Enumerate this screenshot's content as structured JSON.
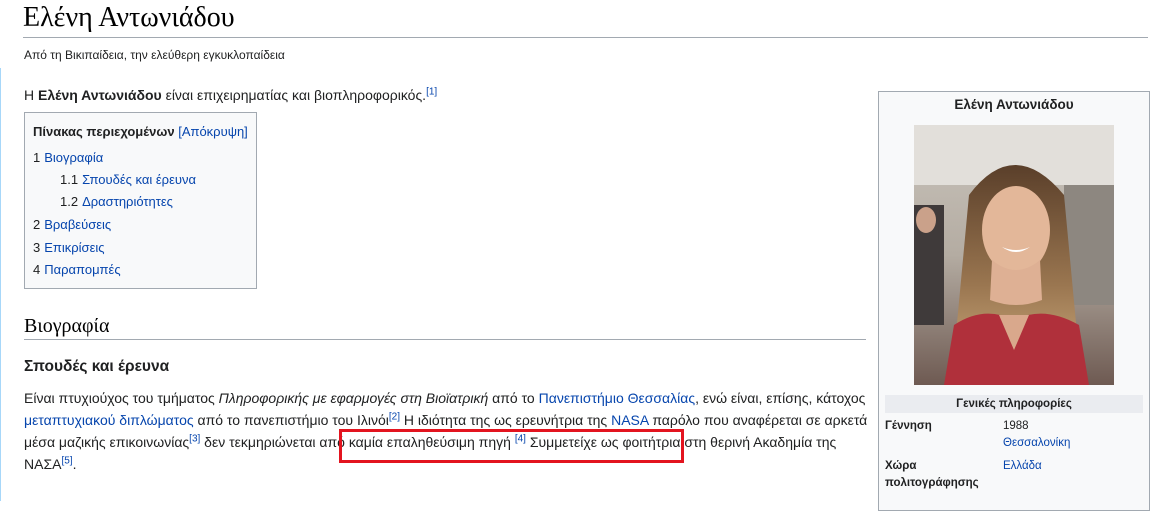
{
  "page": {
    "title": "Ελένη Αντωνιάδου",
    "tagline": "Από τη Βικιπαίδεια, την ελεύθερη εγκυκλοπαίδεια"
  },
  "intro": {
    "prefix": "Η ",
    "name_bold": "Ελένη Αντωνιάδου",
    "suffix": " είναι επιχειρηματίας και βιοπληροφορικός.",
    "ref": "[1]"
  },
  "toc": {
    "title": "Πίνακας περιεχομένων",
    "toggle": "[Απόκρυψη]",
    "items": [
      {
        "num": "1",
        "label": "Βιογραφία"
      },
      {
        "num": "1.1",
        "label": "Σπουδές και έρευνα"
      },
      {
        "num": "1.2",
        "label": "Δραστηριότητες"
      },
      {
        "num": "2",
        "label": "Βραβεύσεις"
      },
      {
        "num": "3",
        "label": "Επικρίσεις"
      },
      {
        "num": "4",
        "label": "Παραπομπές"
      }
    ]
  },
  "section": {
    "heading": "Βιογραφία",
    "subheading": "Σπουδές και έρευνα"
  },
  "paragraph": {
    "t1": "Είναι πτυχιούχος του τμήματος ",
    "t2_italic": "Πληροφορικής με εφαρμογές στη Βιοϊατρική",
    "t3": " από το ",
    "link_university": "Πανεπιστήμιο Θεσσαλίας",
    "t4": ", ενώ είναι, επίσης, κάτοχος  ",
    "link_masters": "μεταπτυχιακού διπλώματος",
    "t5": " από το πανεπιστήμιο του Ιλινόι",
    "ref2": "[2]",
    "t6": " Η ιδιότητα της ως ερευνήτρια της ",
    "link_nasa": "NASA",
    "t7": " παρόλο που αναφέρεται σε αρκετά μέσα μαζικής επικοινωνίας",
    "ref3": "[3]",
    "t8": " δεν τεκμηριώνεται από καμία επαληθεύσιμη πηγή ",
    "ref4": "[4]",
    "t9": " Συμμετείχε ως φοιτήτρια στη θερινή Ακαδημία της ΝΑΣΑ",
    "ref5": "[5]",
    "t10": "."
  },
  "infobox": {
    "name": "Ελένη Αντωνιάδου",
    "section_title": "Γενικές πληροφορίες",
    "birth_label": "Γέννηση",
    "birth_year": "1988",
    "birth_place": "Θεσσαλονίκη",
    "citizenship_label": "Χώρα πολιτογράφησης",
    "citizenship_value": "Ελλάδα"
  },
  "colors": {
    "link": "#0645ad",
    "highlight_box": "#e3141f",
    "infobox_bg": "#f8f9fa"
  }
}
